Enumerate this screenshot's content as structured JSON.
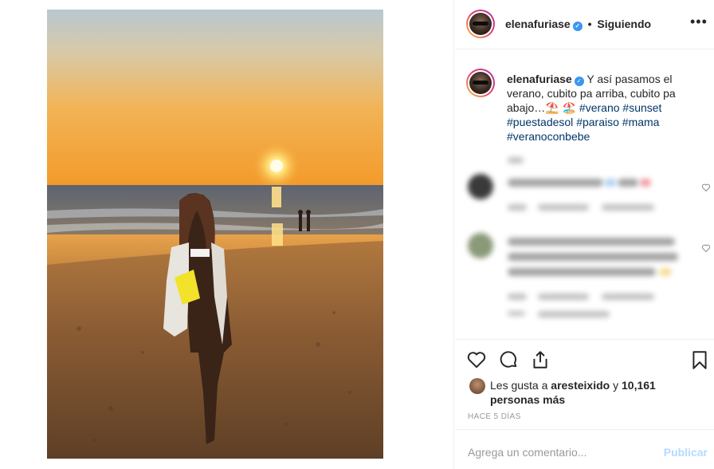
{
  "post": {
    "username": "elenafuriase",
    "separator": "•",
    "follow_status": "Siguiendo",
    "more_options": "•••"
  },
  "caption": {
    "username": "elenafuriase",
    "text_before_emoji": "Y así pasamos el verano, cubito pa arriba, cubito pa abajo…",
    "emojis": "⛱️ 🏖️",
    "hashtags": [
      "#verano",
      "#sunset",
      "#puestadesol",
      "#paraiso",
      "#mama",
      "#veranoconbebe"
    ]
  },
  "likes": {
    "prefix": "Les gusta a",
    "liker": "aresteixido",
    "connector": "y",
    "count_text": "10,161 personas más"
  },
  "timestamp": "HACE 5 DÍAS",
  "comment": {
    "placeholder": "Agrega un comentario...",
    "publish_label": "Publicar"
  },
  "colors": {
    "accent_blue": "#3897f0",
    "hashtag": "#003569",
    "muted": "#999999",
    "publish_disabled": "#b3dbff"
  },
  "icons": [
    "verified-badge-icon",
    "more-options-icon",
    "heart-icon",
    "comment-icon",
    "share-icon",
    "bookmark-icon"
  ]
}
